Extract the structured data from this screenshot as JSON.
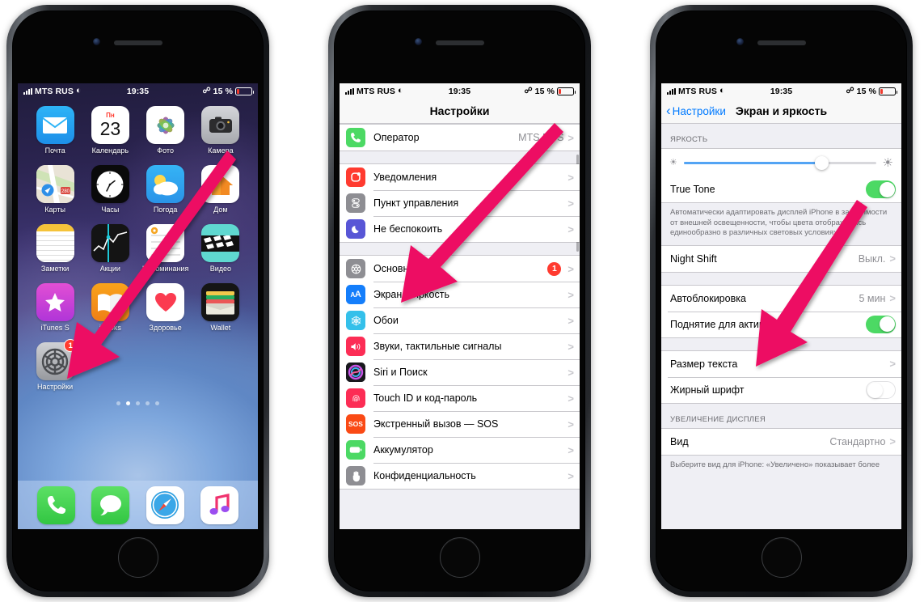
{
  "status_bar": {
    "carrier": "MTS RUS",
    "time": "19:35",
    "battery_percent": "15 %",
    "signal_icon": "cellular-bars-icon",
    "wifi_icon": "wifi-icon",
    "bluetooth_icon": "bluetooth-icon",
    "battery_icon": "battery-icon"
  },
  "phone1": {
    "name": "home-screen",
    "apps": [
      {
        "label": "Почта",
        "icon": "mail-icon"
      },
      {
        "label": "Календарь",
        "icon": "calendar-icon",
        "cal_weekday": "Пн",
        "cal_day": "23"
      },
      {
        "label": "Фото",
        "icon": "photos-icon"
      },
      {
        "label": "Камера",
        "icon": "camera-icon"
      },
      {
        "label": "Карты",
        "icon": "maps-icon"
      },
      {
        "label": "Часы",
        "icon": "clock-icon"
      },
      {
        "label": "Погода",
        "icon": "weather-icon"
      },
      {
        "label": "Дом",
        "icon": "home-app-icon"
      },
      {
        "label": "Заметки",
        "icon": "notes-icon"
      },
      {
        "label": "Акции",
        "icon": "stocks-icon"
      },
      {
        "label": "Напоминания",
        "icon": "reminders-icon"
      },
      {
        "label": "Видео",
        "icon": "videos-icon"
      },
      {
        "label": "iTunes S",
        "icon": "itunes-store-icon"
      },
      {
        "label": "iBooks",
        "icon": "ibooks-icon"
      },
      {
        "label": "Здоровье",
        "icon": "health-icon"
      },
      {
        "label": "Wallet",
        "icon": "wallet-icon"
      },
      {
        "label": "Настройки",
        "icon": "settings-gear-icon",
        "badge": "1"
      }
    ],
    "page_dots": {
      "count": 5,
      "active_index": 1
    },
    "dock": [
      {
        "label": "Телефон",
        "icon": "phone-icon"
      },
      {
        "label": "Сообщения",
        "icon": "messages-icon"
      },
      {
        "label": "Safari",
        "icon": "safari-compass-icon"
      },
      {
        "label": "Музыка",
        "icon": "music-note-icon"
      }
    ]
  },
  "phone2": {
    "name": "settings-list-screen",
    "nav_title": "Настройки",
    "groups": [
      {
        "rows": [
          {
            "label": "Оператор",
            "value": "MTS RUS",
            "icon": "phone-green-icon",
            "chevron": ">"
          }
        ]
      },
      {
        "rows": [
          {
            "label": "Уведомления",
            "icon": "notifications-icon",
            "chevron": ">"
          },
          {
            "label": "Пункт управления",
            "icon": "control-center-icon",
            "chevron": ">"
          },
          {
            "label": "Не беспокоить",
            "icon": "moon-icon",
            "chevron": ">"
          }
        ]
      },
      {
        "rows": [
          {
            "label": "Основные",
            "icon": "gear-icon",
            "badge": "1",
            "chevron": ">"
          },
          {
            "label": "Экран и яркость",
            "icon": "display-aa-icon",
            "chevron": ">"
          },
          {
            "label": "Обои",
            "icon": "wallpaper-icon",
            "chevron": ">"
          },
          {
            "label": "Звуки, тактильные сигналы",
            "icon": "sounds-icon",
            "chevron": ">"
          },
          {
            "label": "Siri и Поиск",
            "icon": "siri-icon",
            "chevron": ">"
          },
          {
            "label": "Touch ID и код-пароль",
            "icon": "touch-id-icon",
            "chevron": ">"
          },
          {
            "label": "Экстренный вызов — SOS",
            "icon": "sos-icon",
            "chevron": ">"
          },
          {
            "label": "Аккумулятор",
            "icon": "battery-green-icon",
            "chevron": ">"
          },
          {
            "label": "Конфиденциальность",
            "icon": "privacy-hand-icon",
            "chevron": ">"
          }
        ]
      }
    ]
  },
  "phone3": {
    "name": "display-brightness-screen",
    "back_label": "Настройки",
    "nav_title": "Экран и яркость",
    "brightness_header": "ЯРКОСТЬ",
    "brightness_value": 72,
    "brightness_low_icon": "sun-small-icon",
    "brightness_high_icon": "sun-large-icon",
    "true_tone": {
      "label": "True Tone",
      "state": "on"
    },
    "true_tone_note": "Автоматически адаптировать дисплей iPhone в зависимости от внешней освещенности, чтобы цвета отображались единообразно в различных световых условиях.",
    "night_shift": {
      "label": "Night Shift",
      "value": "Выкл.",
      "chevron": ">"
    },
    "auto_lock": {
      "label": "Автоблокировка",
      "value": "5 мин",
      "chevron": ">"
    },
    "raise_to_wake": {
      "label": "Поднятие для активации",
      "state": "on"
    },
    "text_size": {
      "label": "Размер текста",
      "chevron": ">"
    },
    "bold_text": {
      "label": "Жирный шрифт",
      "state": "off"
    },
    "zoom_header": "УВЕЛИЧЕНИЕ ДИСПЛЕЯ",
    "view": {
      "label": "Вид",
      "value": "Стандартно",
      "chevron": ">"
    },
    "view_note": "Выберите вид для iPhone: «Увеличено» показывает более"
  },
  "annotations": {
    "arrow_color": "#ED1164",
    "arrows": [
      {
        "name": "arrow-to-settings-app",
        "from": "Дом app area",
        "to": "Настройки app icon"
      },
      {
        "name": "arrow-to-display-brightness",
        "from": "top right of settings list",
        "to": "Экран и яркость row"
      },
      {
        "name": "arrow-to-true-tone-toggle",
        "from": "bottom left",
        "to": "True Tone toggle"
      }
    ]
  }
}
